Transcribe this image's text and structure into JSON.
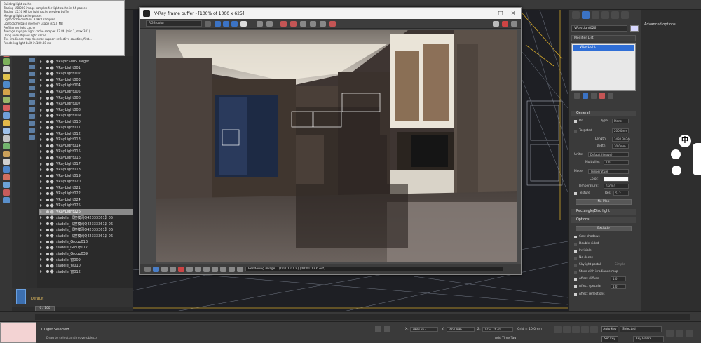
{
  "vfb": {
    "title": "V-Ray frame buffer - [100% of 1000 x 625]",
    "channel": "RGB color",
    "status": "Rendering image... [00:01:01.9] [00:01:12.6 est]"
  },
  "log": [
    "Building light cache",
    "Tracing 150000 image samples for light cache in 64 passes",
    "Tracing 15.16 KB for light cache preview buffer",
    "Merging light cache passes",
    "Light cache contains 33974 samples",
    "Light cache base memory usage is 5.0 MB",
    "Prefiltering light cache",
    "Average rays per light cache sample: 27.86 (min 1, max 301)",
    "Using unmultiplied light cache",
    "The irradiance map does not support reflective caustics, first...",
    "Rendering light built in 180.38 ms"
  ],
  "scene": {
    "items": [
      "VRayIES005.Target",
      "VRayLight001",
      "VRayLight002",
      "VRayLight003",
      "VRayLight004",
      "VRayLight005",
      "VRayLight006",
      "VRayLight007",
      "VRayLight008",
      "VRayLight009",
      "VRayLight010",
      "VRayLight011",
      "VRayLight012",
      "VRayLight013",
      "VRayLight014",
      "VRayLight015",
      "VRayLight016",
      "VRayLight017",
      "VRayLight018",
      "VRayLight019",
      "VRayLight020",
      "VRayLight021",
      "VRayLight022",
      "VRayLight024",
      "VRayLight025",
      "VRayLight026",
      "siadele_【搜模网Q42333361】05",
      "siadele_【搜模网Q42333361】06",
      "siadele_【搜模网Q42333361】06",
      "siadele_【搜模网Q42333361】06",
      "siadele_Group016",
      "siadele_Group017",
      "siadele_Group039",
      "siadele_窗009",
      "siadele_窗010",
      "siadele_窗012"
    ],
    "selected_index": 25,
    "layer": "Default"
  },
  "cmd": {
    "object_name": "VRayLight026",
    "modifier_list": "Modifier List",
    "stack_item": "VRayLight",
    "general": "General",
    "on": "On",
    "type_label": "Type:",
    "type_value": "Plane",
    "targeted": "Targeted",
    "target_value": "200.0mm",
    "length_label": "Length:",
    "length_value": "3480.303m",
    "width_label": "Width:",
    "width_value": "30.0mm",
    "units_label": "Units:",
    "units_value": "Default (image)",
    "multiplier_label": "Multiplier:",
    "multiplier_value": "7.0",
    "mode_label": "Mode:",
    "mode_value": "Temperature",
    "color_label": "Color:",
    "temperature_label": "Temperature:",
    "temperature_value": "6500.0",
    "texture_label": "Texture",
    "res_label": "Res:",
    "res_value": "512",
    "no_map": "No Map",
    "rect_disc": "Rectangle/Disc light",
    "options": "Options",
    "exclude": "Exclude",
    "cast_shadows": "Cast shadows",
    "double_sided": "Double-sided",
    "invisible": "Invisible",
    "no_decay": "No decay",
    "skylight_portal": "Skylight portal",
    "simple": "Simple",
    "store_irradiance": "Store with irradiance map",
    "affect_diffuse": "Affect diffuse",
    "affect_diffuse_value": "1.0",
    "affect_specular": "Affect specular",
    "affect_specular_value": "1.0",
    "affect_reflections": "Affect reflections",
    "advanced_options": "Advanced options"
  },
  "ime": {
    "lang": "中"
  },
  "bottom": {
    "frame": "0 / 100",
    "selection": "1 Light Selected",
    "prompt": "Drag to select and move objects",
    "x_label": "X:",
    "x_value": "3989.863",
    "y_label": "Y:",
    "y_value": "-661.896",
    "z_label": "Z:",
    "z_value": "1254.262m",
    "grid": "Grid = 10.0mm",
    "add_time_tag": "Add Time Tag",
    "auto_key": "Auto Key",
    "set_key": "Set Key",
    "selected": "Selected",
    "key_filters": "Key Filters..."
  },
  "colors": {
    "selection_blue": "#2f6ed6",
    "layer_label": "#e8c060",
    "viewport_wire": "#c9a52a"
  }
}
